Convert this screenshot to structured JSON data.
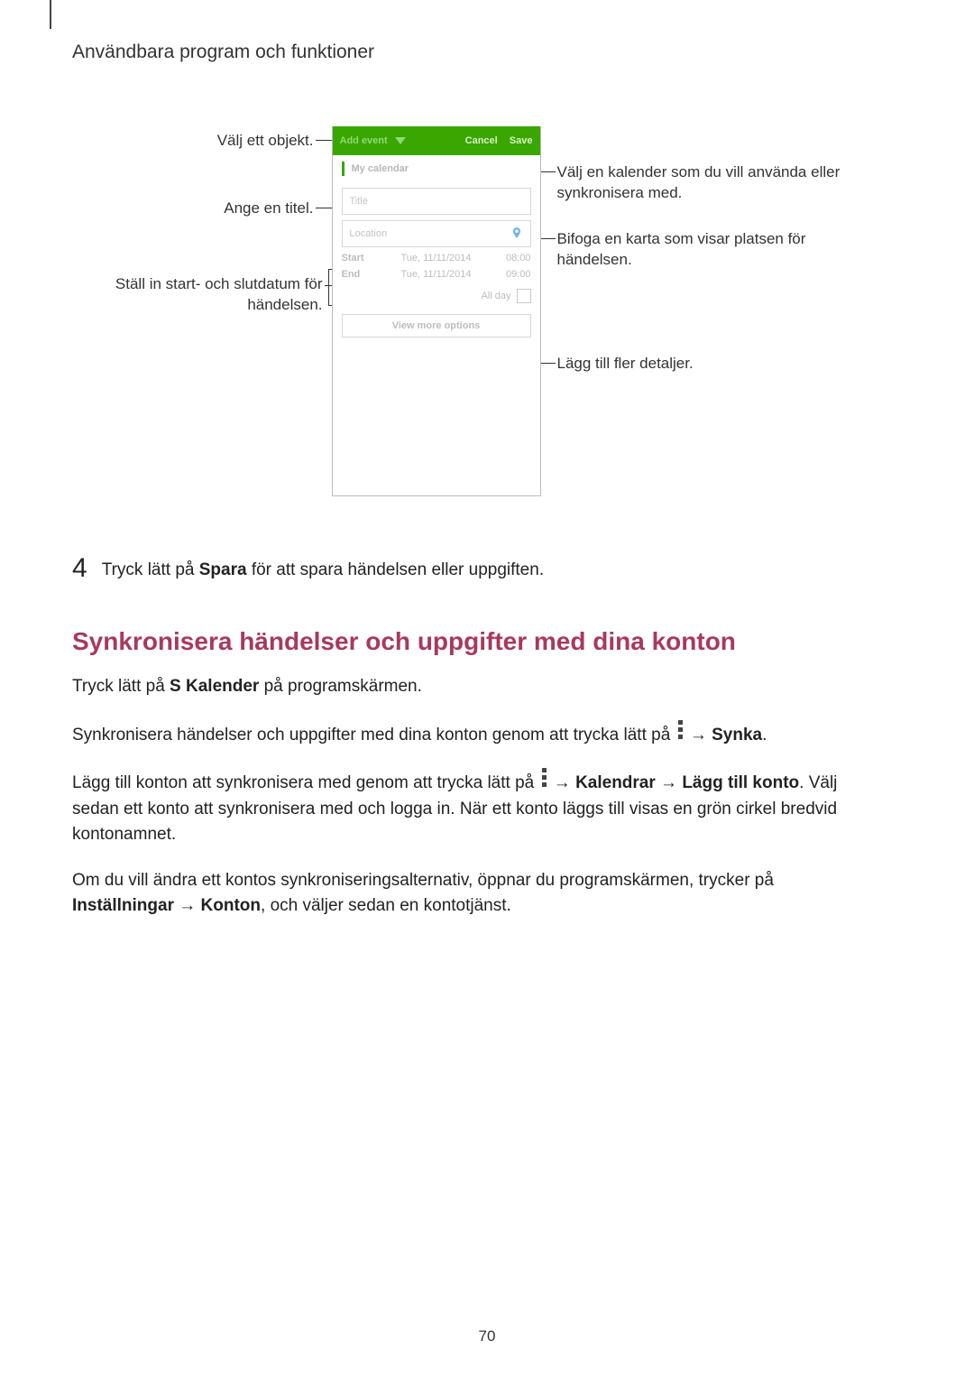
{
  "header": "Användbara program och funktioner",
  "callouts": {
    "select_object": "Välj ett objekt.",
    "title": "Ange en titel.",
    "dates": "Ställ in start- och slutdatum för händelsen.",
    "calendar": "Välj en kalender som du vill använda eller synkronisera med.",
    "map": "Bifoga en karta som visar platsen för händelsen.",
    "more": "Lägg till fler detaljer."
  },
  "phone": {
    "titlebar": {
      "label": "Add event",
      "cancel": "Cancel",
      "save": "Save"
    },
    "calendar_row": "My calendar",
    "title_placeholder": "Title",
    "location_placeholder": "Location",
    "start": {
      "label": "Start",
      "date": "Tue, 11/11/2014",
      "time": "08:00"
    },
    "end": {
      "label": "End",
      "date": "Tue, 11/11/2014",
      "time": "09:00"
    },
    "allday": "All day",
    "more_button": "View more options"
  },
  "step4": {
    "num": "4",
    "prefix": "Tryck lätt på ",
    "bold": "Spara",
    "suffix": " för att spara händelsen eller uppgiften."
  },
  "sync_heading": "Synkronisera händelser och uppgifter med dina konton",
  "para1": {
    "a": "Tryck lätt på ",
    "b": "S Kalender",
    "c": " på programskärmen."
  },
  "para2": {
    "a": "Synkronisera händelser och uppgifter med dina konton genom att trycka lätt på ",
    "arrow": " → ",
    "b": "Synka",
    "dot": "."
  },
  "para3": {
    "a": "Lägg till konton att synkronisera med genom att trycka lätt på ",
    "arrow": " → ",
    "b": "Kalendrar",
    "arrow2": " → ",
    "c": "Lägg till konto",
    "dot": ". ",
    "rest": "Välj sedan ett konto att synkronisera med och logga in. När ett konto läggs till visas en grön cirkel bredvid kontonamnet."
  },
  "para4": {
    "a": "Om du vill ändra ett kontos synkroniseringsalternativ, öppnar du programskärmen, trycker på ",
    "b": "Inställningar",
    "arrow": " → ",
    "c": "Konton",
    "rest": ", och väljer sedan en kontotjänst."
  },
  "page_number": "70"
}
